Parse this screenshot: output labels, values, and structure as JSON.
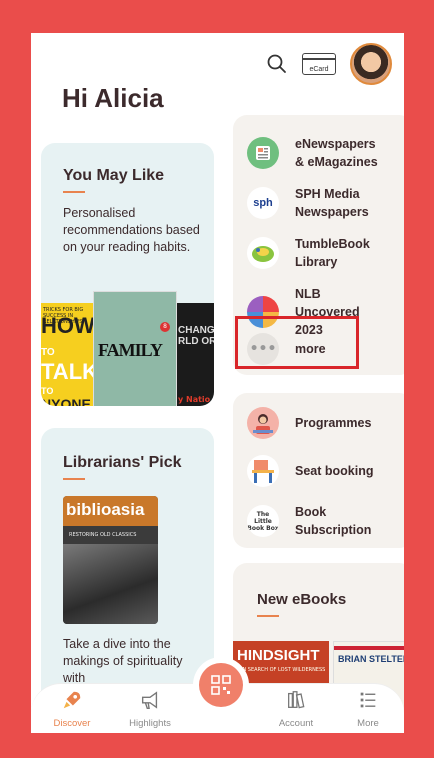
{
  "header": {
    "greeting": "Hi Alicia",
    "ecard_label": "eCard"
  },
  "you_may_like": {
    "title": "You May Like",
    "description": "Personalised recommendations based on your reading habits.",
    "books": [
      {
        "cover_text": [
          "HOW",
          "TO",
          "TALK",
          "TO",
          "NYONE"
        ],
        "top": "TRICKS FOR BIG SUCCESS IN RELATIONSHIPS"
      },
      {
        "cover_text": [
          "FAMILY"
        ]
      },
      {
        "cover_text": [
          "CHANGIN",
          "RLD ORD",
          "y Natio"
        ]
      }
    ]
  },
  "librarians_pick": {
    "title": "Librarians' Pick",
    "book_title": "biblioasia",
    "book_subtitle": "RESTORING OLD CLASSICS",
    "description": "Take a dive into the makings of spirituality with"
  },
  "resources": {
    "items": [
      {
        "label": "eNewspapers & eMagazines",
        "icon": "newspaper-icon"
      },
      {
        "label": "SPH Media Newspapers",
        "icon": "sph-logo-icon",
        "icon_text": "sph"
      },
      {
        "label": "TumbleBook Library",
        "icon": "tumblebook-icon"
      },
      {
        "label": "NLB Uncovered 2023",
        "icon": "nlb-uncovered-icon"
      },
      {
        "label": "more",
        "icon": "ellipsis-icon",
        "icon_text": "•••"
      }
    ]
  },
  "services": {
    "items": [
      {
        "label": "Programmes",
        "icon": "programmes-icon"
      },
      {
        "label": "Seat booking",
        "icon": "seat-booking-icon"
      },
      {
        "label": "Book Subscription",
        "icon": "book-subscription-icon",
        "icon_text": "The Little Book Box"
      }
    ]
  },
  "new_ebooks": {
    "title": "New eBooks",
    "books": [
      {
        "title": "HINDSIGHT",
        "subtitle": "IN SEARCH OF LOST WILDERNESS"
      },
      {
        "title": "BRIAN STELTER"
      }
    ]
  },
  "bottom_nav": {
    "items": [
      {
        "label": "Discover",
        "active": true
      },
      {
        "label": "Highlights",
        "active": false
      },
      {
        "label": "Account",
        "active": false
      },
      {
        "label": "More",
        "active": false
      }
    ]
  },
  "colors": {
    "accent": "#e8834e",
    "frame": "#ea4d4b",
    "highlight_box": "#d9262a"
  }
}
